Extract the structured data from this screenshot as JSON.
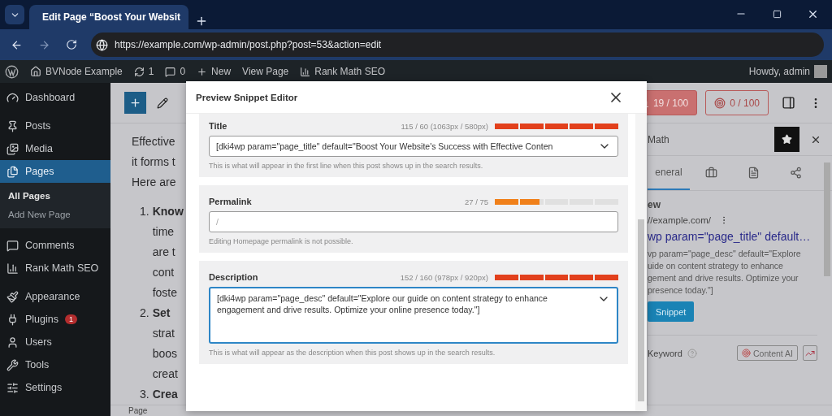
{
  "browser": {
    "tab_title": "Edit Page “Boost Your Websit",
    "url": "https://example.com/wp-admin/post.php?post=53&action=edit"
  },
  "admin_bar": {
    "site": "BVNode Example",
    "updates": "1",
    "comments": "0",
    "new": "New",
    "view": "View Page",
    "seo": "Rank Math SEO",
    "greeting": "Howdy, admin"
  },
  "sidebar": {
    "groups": [
      {
        "items": [
          {
            "label": "Dashboard",
            "selected": false
          }
        ]
      },
      {
        "items": [
          {
            "label": "Posts",
            "selected": false
          },
          {
            "label": "Media",
            "selected": false
          },
          {
            "label": "Pages",
            "selected": true,
            "children": [
              {
                "label": "All Pages",
                "selected": true
              },
              {
                "label": "Add New Page",
                "selected": false
              }
            ]
          }
        ]
      },
      {
        "items": [
          {
            "label": "Comments",
            "selected": false
          },
          {
            "label": "Rank Math SEO",
            "selected": false
          }
        ]
      },
      {
        "items": [
          {
            "label": "Appearance",
            "selected": false
          },
          {
            "label": "Plugins",
            "selected": false,
            "badge": "1"
          },
          {
            "label": "Users",
            "selected": false
          },
          {
            "label": "Tools",
            "selected": false
          },
          {
            "label": "Settings",
            "selected": false
          }
        ]
      }
    ]
  },
  "editor": {
    "paragraph_lines": [
      "Effective",
      "it forms t",
      "Here are"
    ],
    "list": [
      {
        "number": "1.",
        "lines": [
          "Know",
          "time",
          "are t",
          "cont",
          "foste"
        ]
      },
      {
        "number": "2.",
        "lines": [
          "Set",
          "strat",
          "boos",
          "creat"
        ]
      },
      {
        "number": "3.",
        "lines": [
          "Crea"
        ]
      }
    ],
    "footer": "Page"
  },
  "scores": [
    {
      "label": "19 / 100",
      "kind": "seo"
    },
    {
      "label": "0 / 100",
      "kind": "content"
    }
  ],
  "right_panel": {
    "title": "Math",
    "tabs": [
      {
        "label": "eneral",
        "selected": true
      },
      {
        "selected": false
      },
      {
        "selected": false
      },
      {
        "selected": false
      }
    ],
    "heading": "ew",
    "url": "//example.com/",
    "snippet_title": "wp param=\"page_title\" default…",
    "snippet_desc": [
      "vp param=\"page_desc\" default=\"Explore",
      "uide on content strategy to enhance",
      "gement and drive results. Optimize your",
      "presence today.\"]"
    ],
    "edit_button": "Snippet",
    "keyword_label": "Keyword",
    "content_ai": "Content AI"
  },
  "modal": {
    "title": "Preview Snippet Editor",
    "sections": [
      {
        "label": "Title",
        "kind": "input",
        "counter": "115 / 60 (1063px / 580px)",
        "level": 1,
        "color": "#e2401c",
        "value": "[dki4wp param=\"page_title\" default=\"Boost Your Website's Success with Effective Conten",
        "variables": true,
        "focused": false,
        "help": "This is what will appear in the first line when this post shows up in the search results."
      },
      {
        "label": "Permalink",
        "kind": "input",
        "counter": "27 / 75",
        "level": 0.36,
        "color": "#f0801a",
        "placeholder": "/",
        "variables": false,
        "focused": false,
        "help": "Editing Homepage permalink is not possible."
      },
      {
        "label": "Description",
        "kind": "textarea",
        "counter": "152 / 160 (978px / 920px)",
        "level": 1,
        "color": "#e2401c",
        "value": "[dki4wp param=\"page_desc\" default=\"Explore our guide on content strategy to enhance engagement and drive results. Optimize your online presence today.\"]",
        "variables": true,
        "focused": true,
        "help": "This is what will appear as the description when this post shows up in the search results."
      }
    ]
  }
}
